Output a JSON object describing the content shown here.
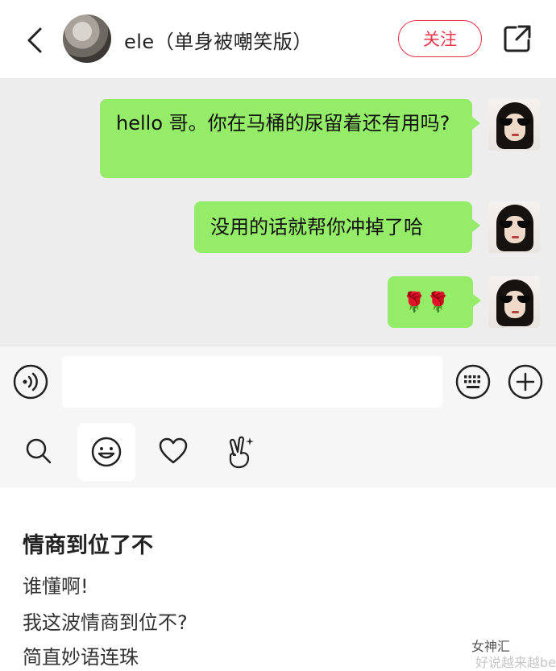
{
  "header": {
    "contact_name": "ele（单身被嘲笑版）",
    "follow_label": "关注",
    "icons": [
      "back-arrow-icon",
      "share-icon"
    ]
  },
  "chat": {
    "messages": [
      {
        "sender": "me",
        "text": "hello 哥。你在马桶的尿留着还有用吗?"
      },
      {
        "sender": "me",
        "text": "没用的话就帮你冲掉了哈"
      },
      {
        "sender": "me",
        "text": "🌹🌹"
      }
    ]
  },
  "input_bar": {
    "text_value": "",
    "icons": [
      "voice-icon",
      "keyboard-icon",
      "plus-icon"
    ]
  },
  "toolbar": {
    "icons": [
      "search-icon",
      "emoji-icon",
      "heart-icon",
      "gesture-icon"
    ],
    "selected": "emoji-icon"
  },
  "caption": {
    "title": "情商到位了不",
    "lines": [
      "谁懂啊!",
      "我这波情商到位不?",
      "简直妙语连珠"
    ]
  },
  "watermark": {
    "text": "女神汇",
    "sub": "好说越来越bet"
  },
  "colors": {
    "bubble": "#95ec69",
    "chat_bg": "#ededed",
    "follow": "#e8364a"
  }
}
